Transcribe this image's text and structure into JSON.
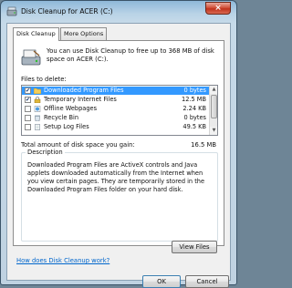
{
  "window": {
    "title": "Disk Cleanup for ACER (C:)",
    "close_glyph": "×"
  },
  "tabs": [
    {
      "label": "Disk Cleanup",
      "active": true
    },
    {
      "label": "More Options",
      "active": false
    }
  ],
  "intro": "You can use Disk Cleanup to free up to 368 MB of disk space on ACER (C:).",
  "files_label": "Files to delete:",
  "files": [
    {
      "name": "Downloaded Program Files",
      "size": "0 bytes",
      "checked": true,
      "selected": true
    },
    {
      "name": "Temporary Internet Files",
      "size": "12.5 MB",
      "checked": true,
      "selected": false
    },
    {
      "name": "Offline Webpages",
      "size": "2.24 KB",
      "checked": false,
      "selected": false
    },
    {
      "name": "Recycle Bin",
      "size": "0 bytes",
      "checked": false,
      "selected": false
    },
    {
      "name": "Setup Log Files",
      "size": "49.5 KB",
      "checked": false,
      "selected": false
    }
  ],
  "total": {
    "label": "Total amount of disk space you gain:",
    "value": "16.5 MB"
  },
  "description": {
    "title": "Description",
    "text": "Downloaded Program Files are ActiveX controls and Java applets downloaded automatically from the Internet when you view certain pages. They are temporarily stored in the Downloaded Program Files folder on your hard disk."
  },
  "buttons": {
    "view_files": "View Files",
    "ok": "OK",
    "cancel": "Cancel"
  },
  "help_link": "How does Disk Cleanup work?",
  "check_glyph": "✔",
  "colors": {
    "selection": "#3399ff",
    "link": "#0066cc",
    "close": "#c0321c"
  }
}
